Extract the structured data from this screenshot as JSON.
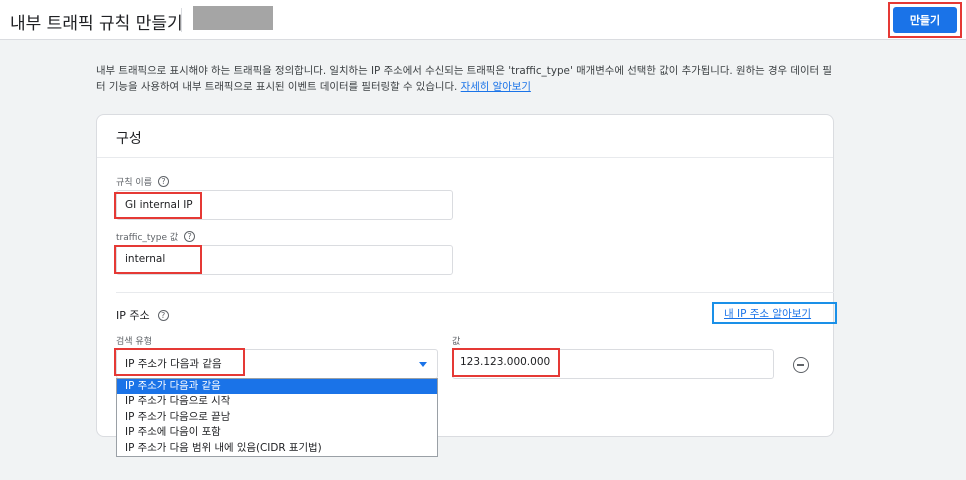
{
  "header": {
    "title": "내부 트래픽 규칙 만들기",
    "create_label": "만들기"
  },
  "description": {
    "text": "내부 트래픽으로 표시해야 하는 트래픽을 정의합니다. 일치하는 IP 주소에서 수신되는 트래픽은 'traffic_type' 매개변수에 선택한 값이 추가됩니다. 원하는 경우 데이터 필터 기능을 사용하여 내부 트래픽으로 표시된 이벤트 데이터를 필터링할 수 있습니다.",
    "link": "자세히 알아보기"
  },
  "config": {
    "title": "구성",
    "rule_name": {
      "label": "규칙 이름",
      "value": "GI internal IP"
    },
    "traffic_type": {
      "label": "traffic_type 값",
      "value": "internal"
    },
    "ip": {
      "title": "IP 주소",
      "my_ip_link": "내 IP 주소 알아보기",
      "match_type_label": "검색 유형",
      "match_type_value": "IP 주소가 다음과 같음",
      "value_label": "값",
      "value": "123.123.000.000"
    }
  },
  "dropdown": {
    "options": [
      "IP 주소가 다음과 같음",
      "IP 주소가 다음으로 시작",
      "IP 주소가 다음으로 끝남",
      "IP 주소에 다음이 포함",
      "IP 주소가 다음 범위 내에 있음(CIDR 표기법)"
    ],
    "selected_index": 0
  },
  "colors": {
    "accent": "#1a73e8",
    "highlight_box": "#e53935"
  },
  "icons": {
    "help": "help-circle-icon",
    "remove": "remove-circle-icon",
    "dropdown": "dropdown-arrow-icon"
  }
}
